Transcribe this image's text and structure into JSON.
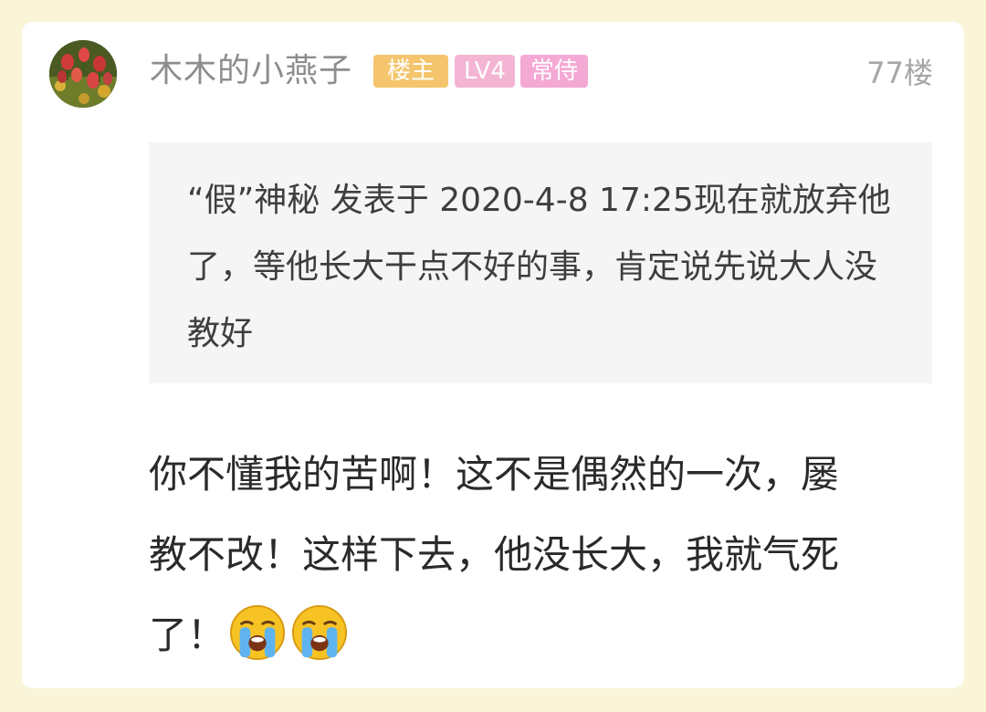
{
  "post": {
    "username": "木木的小燕子",
    "badges": {
      "owner": {
        "label": "楼主",
        "color": "#f5c56d"
      },
      "level": {
        "label": "LV4",
        "color": "#f3b5d3"
      },
      "title": {
        "label": "常侍",
        "color": "#f4a8d4"
      }
    },
    "floor": "77楼",
    "quote": {
      "text": "“假”神秘 发表于 2020-4-8 17:25现在就放弃他了，等他长大干点不好的事，肯定说先说大人没教好"
    },
    "content": {
      "text": "你不懂我的苦啊！这不是偶然的一次，屡教不改！这样下去，他没长大，我就气死了！",
      "emojis": [
        "crying-face-icon",
        "crying-face-icon"
      ]
    }
  },
  "colors": {
    "page_background": "#faf5d9",
    "card_background": "#ffffff",
    "quote_background": "#f5f5f5",
    "username": "#8d8d8d",
    "floor": "#a6a6a6"
  }
}
